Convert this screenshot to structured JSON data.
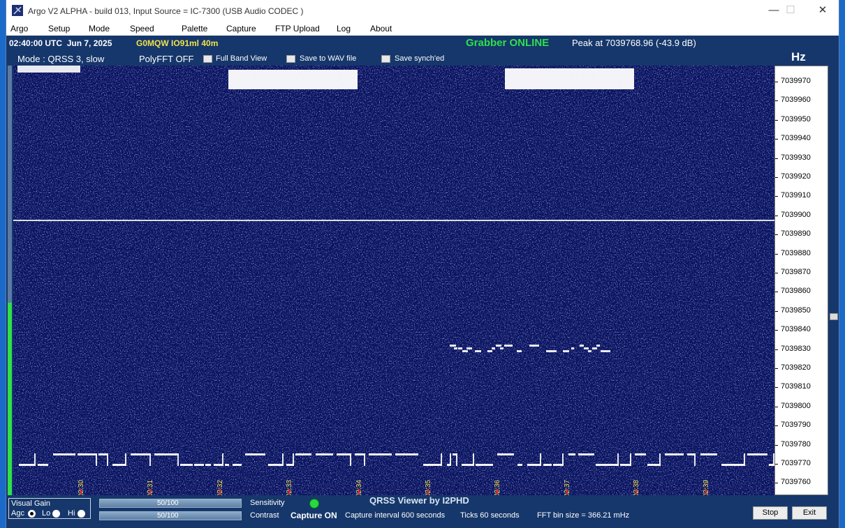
{
  "window": {
    "title": "Argo V2 ALPHA - build 013, Input Source = IC-7300 (USB Audio CODEC )",
    "controls": {
      "minimize": "—",
      "maximize": "☐",
      "close": "✕"
    }
  },
  "menu": [
    "Argo",
    "Setup",
    "Mode",
    "Speed",
    "Palette",
    "Capture",
    "FTP Upload",
    "Log",
    "About"
  ],
  "status": {
    "utc": "02:40:00 UTC  Jun 7, 2025",
    "callsign": "G0MQW IO91ml 40m",
    "grabber": "Grabber ONLINE",
    "peak": "Peak at 7039768.96 (-43.9 dB)"
  },
  "modebar": {
    "mode": "Mode : QRSS 3, slow",
    "polyfft": "PolyFFT OFF",
    "full_band": "Full Band View",
    "save_wav": "Save to WAV file",
    "save_synch": "Save synch'ed"
  },
  "hz_label": "Hz",
  "freq_scale": [
    "7039970",
    "7039960",
    "7039950",
    "7039940",
    "7039930",
    "7039920",
    "7039910",
    "7039900",
    "7039890",
    "7039880",
    "7039870",
    "7039860",
    "7039850",
    "7039840",
    "7039830",
    "7039820",
    "7039810",
    "7039800",
    "7039790",
    "7039780",
    "7039770",
    "7039760"
  ],
  "time_ticks": [
    "02:30",
    "02:31",
    "02:32",
    "02:33",
    "02:34",
    "02:35",
    "02:36",
    "02:37",
    "02:38",
    "02:39"
  ],
  "bottom": {
    "visual_gain": "Visual Gain",
    "agc": "Agc",
    "lo": "Lo",
    "hi": "Hi",
    "sensitivity_value": "50/100",
    "contrast_value": "50/100",
    "sensitivity": "Sensitivity",
    "contrast": "Contrast",
    "qrss_viewer": "QRSS Viewer by I2PHD",
    "capture_on": "Capture ON",
    "interval": "Capture interval 600 seconds",
    "ticks": "Ticks  60 seconds",
    "fft_bin": "FFT bin size = 366.21 mHz",
    "stop": "Stop",
    "exit": "Exit"
  },
  "colors": {
    "waterfall_bg": "#08125e",
    "signal": "#ffffff",
    "grabber_online": "#2ee04c",
    "callsign": "#f0e24a"
  }
}
